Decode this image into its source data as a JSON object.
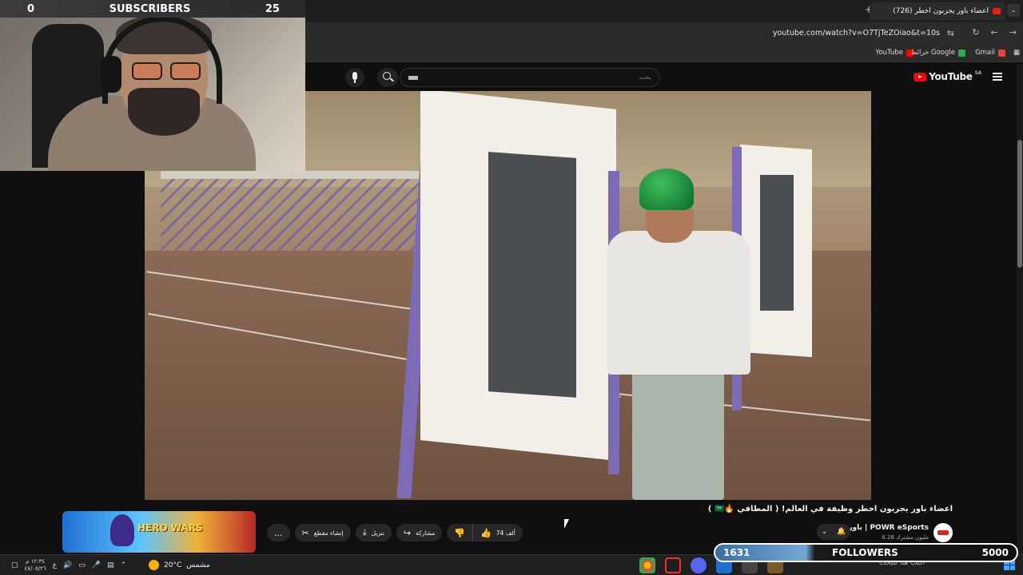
{
  "browser": {
    "tab_title": "(726) اعضاء باور يجربون اخطر",
    "url": "youtube.com/watch?v=O7TjTeZOiao&t=10s",
    "bookmarks": [
      {
        "label": "YouTube",
        "color": "#ff0000"
      },
      {
        "label": "خرائط Google",
        "color": "#34a853"
      },
      {
        "label": "Gmail",
        "color": "#ea4335"
      }
    ]
  },
  "youtube": {
    "logo_text": "YouTube",
    "country": "SA",
    "search_placeholder": "بحث"
  },
  "stream_overlay": {
    "subscribers_label": "SUBSCRIBERS",
    "subscribers_current": "0",
    "subscribers_goal": "25",
    "followers_label": "FOLLOWERS",
    "followers_current": "1631",
    "followers_goal": "5000"
  },
  "video": {
    "title": "اعضاء باور يجربون اخطر وظيفة في العالم! ( المطافي 🔥🇸🇦 )",
    "channel_name": "باور | POWR eSports",
    "channel_subs": "6.28 مليون مشترك",
    "likes": "74 ألف",
    "share_label": "مشاركة",
    "download_label": "تنزيل",
    "clip_label": "إنشاء مقطع",
    "more_label": "..."
  },
  "ad": {
    "logo_text": "HERO WARS"
  },
  "taskbar": {
    "time": "١٢:٣٤ م",
    "date": "٤٧/٠٥/٢٦",
    "lang": "ع",
    "weather_temp": "20°C",
    "weather_text": "مشمس",
    "search_text": "اكتب هنا للبحث"
  }
}
